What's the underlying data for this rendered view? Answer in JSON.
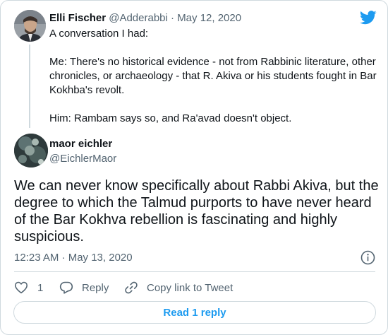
{
  "parent_tweet": {
    "author_name": "Elli Fischer",
    "author_handle": "@Adderabbi",
    "separator": "·",
    "date": "May 12, 2020",
    "paragraphs": [
      "A conversation I had:",
      "Me: There's no historical evidence - not from Rabbinic literature, other chronicles, or archaeology - that R. Akiva or his students fought in Bar Kokhba's revolt.",
      "Him: Rambam says so, and Ra'avad doesn't object."
    ]
  },
  "main_tweet": {
    "author_name": "maor eichler",
    "author_handle": "@EichlerMaor",
    "text": "We can never know specifically about Rabbi Akiva, but the degree to which the Talmud purports to have never heard of the Bar Kokhva rebellion is fascinating and highly suspicious.",
    "timestamp": "12:23 AM · May 13, 2020"
  },
  "actions": {
    "like_count": "1",
    "reply_label": "Reply",
    "copy_link_label": "Copy link to Tweet"
  },
  "read_replies_label": "Read 1 reply",
  "colors": {
    "brand_blue": "#1d9bf0",
    "secondary_text": "#536471",
    "border": "#cfd9de"
  },
  "icons": [
    "twitter-bird-icon",
    "info-icon",
    "heart-icon",
    "reply-icon",
    "link-icon"
  ]
}
